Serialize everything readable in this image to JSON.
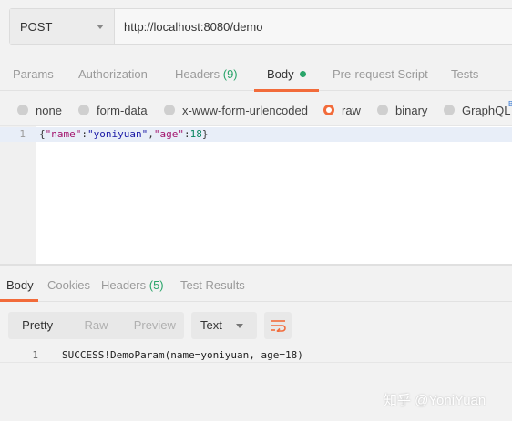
{
  "request": {
    "method": "POST",
    "url": "http://localhost:8080/demo"
  },
  "request_tabs": [
    {
      "label": "Params"
    },
    {
      "label": "Authorization"
    },
    {
      "label": "Headers ",
      "count": "(9)"
    },
    {
      "label": "Body",
      "active": true
    },
    {
      "label": "Pre-request Script"
    },
    {
      "label": "Tests"
    }
  ],
  "body_types": [
    {
      "label": "none"
    },
    {
      "label": "form-data"
    },
    {
      "label": "x-www-form-urlencoded"
    },
    {
      "label": "raw",
      "selected": true
    },
    {
      "label": "binary"
    },
    {
      "label": "GraphQL"
    }
  ],
  "graphql_badge": "B",
  "editor": {
    "line_number": "1",
    "code": "{\"name\":\"yoniyuan\",\"age\":18}",
    "tokens": {
      "open": "{",
      "key1": "\"name\"",
      "colon1": ":",
      "val1": "\"yoniyuan\"",
      "comma": ",",
      "key2": "\"age\"",
      "colon2": ":",
      "val2": "18",
      "close": "}"
    }
  },
  "response_tabs": [
    {
      "label": "Body",
      "active": true
    },
    {
      "label": "Cookies"
    },
    {
      "label": "Headers ",
      "count": "(5)"
    },
    {
      "label": "Test Results"
    }
  ],
  "response_view": {
    "modes": [
      "Pretty",
      "Raw",
      "Preview"
    ],
    "active_mode": "Pretty",
    "format": "Text",
    "wrap_icon": "wrap-lines-icon"
  },
  "response_body": {
    "line_number": "1",
    "text": "SUCCESS!DemoParam(name=yoniyuan, age=18)"
  },
  "watermark": "知乎 @YoniYuan",
  "colors": {
    "accent": "#f26b3a",
    "count_green": "#2aa56a"
  }
}
